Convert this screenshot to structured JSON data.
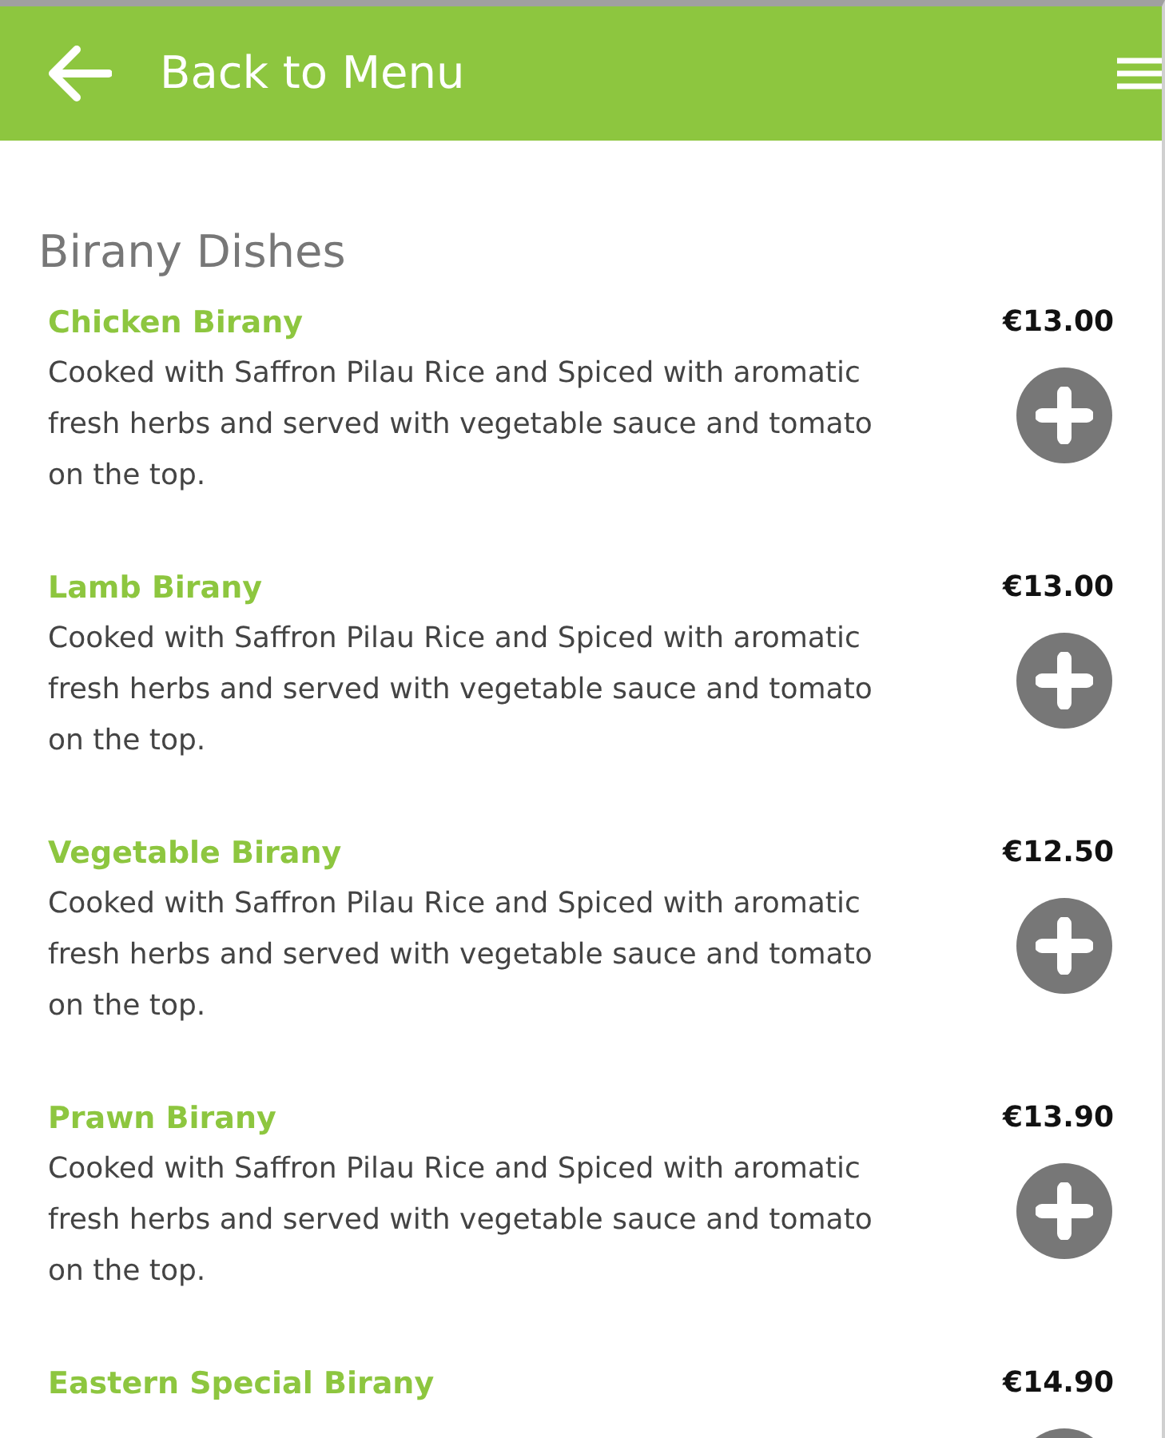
{
  "header": {
    "title": "Back to Menu"
  },
  "section": {
    "title": "Birany Dishes"
  },
  "items": [
    {
      "name": "Chicken Birany",
      "price": "€13.00",
      "description": "Cooked with Saffron Pilau Rice and Spiced with aromatic fresh herbs and served with vegetable sauce and tomato on the top."
    },
    {
      "name": "Lamb Birany",
      "price": "€13.00",
      "description": "Cooked with Saffron Pilau Rice and Spiced with aromatic fresh herbs and served with vegetable sauce and tomato on the top."
    },
    {
      "name": "Vegetable Birany",
      "price": "€12.50",
      "description": "Cooked with Saffron Pilau Rice and Spiced with aromatic fresh herbs and served with vegetable sauce and tomato on the top."
    },
    {
      "name": "Prawn Birany",
      "price": "€13.90",
      "description": "Cooked with Saffron Pilau Rice and Spiced with aromatic fresh herbs and served with vegetable sauce and tomato on the top."
    },
    {
      "name": "Eastern Special Birany",
      "price": "€14.90"
    }
  ]
}
